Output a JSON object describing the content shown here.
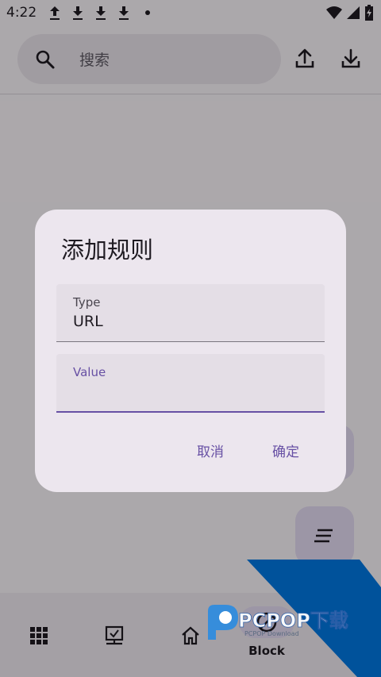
{
  "status_bar": {
    "time": "4:22"
  },
  "search": {
    "placeholder": "搜索"
  },
  "bottom_nav": {
    "active_label": "Block"
  },
  "dialog": {
    "title": "添加规则",
    "type_field": {
      "label": "Type",
      "value": "URL"
    },
    "value_field": {
      "label": "Value",
      "value": ""
    },
    "cancel_label": "取消",
    "confirm_label": "确定"
  },
  "watermark": {
    "brand": "PCPOP下载",
    "tagline": "PCPOP Download"
  },
  "colors": {
    "primary": "#6750a4",
    "surface": "#ece6ee",
    "watermark_blue": "#00529b"
  }
}
